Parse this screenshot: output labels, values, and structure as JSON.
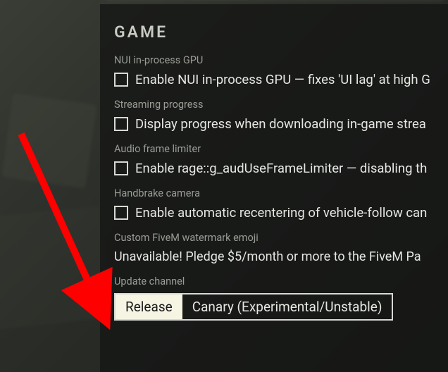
{
  "section_title": "GAME",
  "settings": {
    "nui_gpu": {
      "label": "NUI in-process GPU",
      "text": "Enable NUI in-process GPU — fixes 'UI lag' at high G"
    },
    "streaming": {
      "label": "Streaming progress",
      "text": "Display progress when downloading in-game strea"
    },
    "audio": {
      "label": "Audio frame limiter",
      "text": "Enable rage::g_audUseFrameLimiter — disabling th"
    },
    "handbrake": {
      "label": "Handbrake camera",
      "text": "Enable automatic recentering of vehicle-follow can"
    },
    "watermark": {
      "label": "Custom FiveM watermark emoji",
      "text": "Unavailable! Pledge $5/month or more to the FiveM Pa"
    },
    "update_channel": {
      "label": "Update channel",
      "options": {
        "release": "Release",
        "canary": "Canary (Experimental/Unstable)"
      },
      "selected": "release"
    }
  },
  "annotation": {
    "arrow_color": "#ff0000"
  }
}
